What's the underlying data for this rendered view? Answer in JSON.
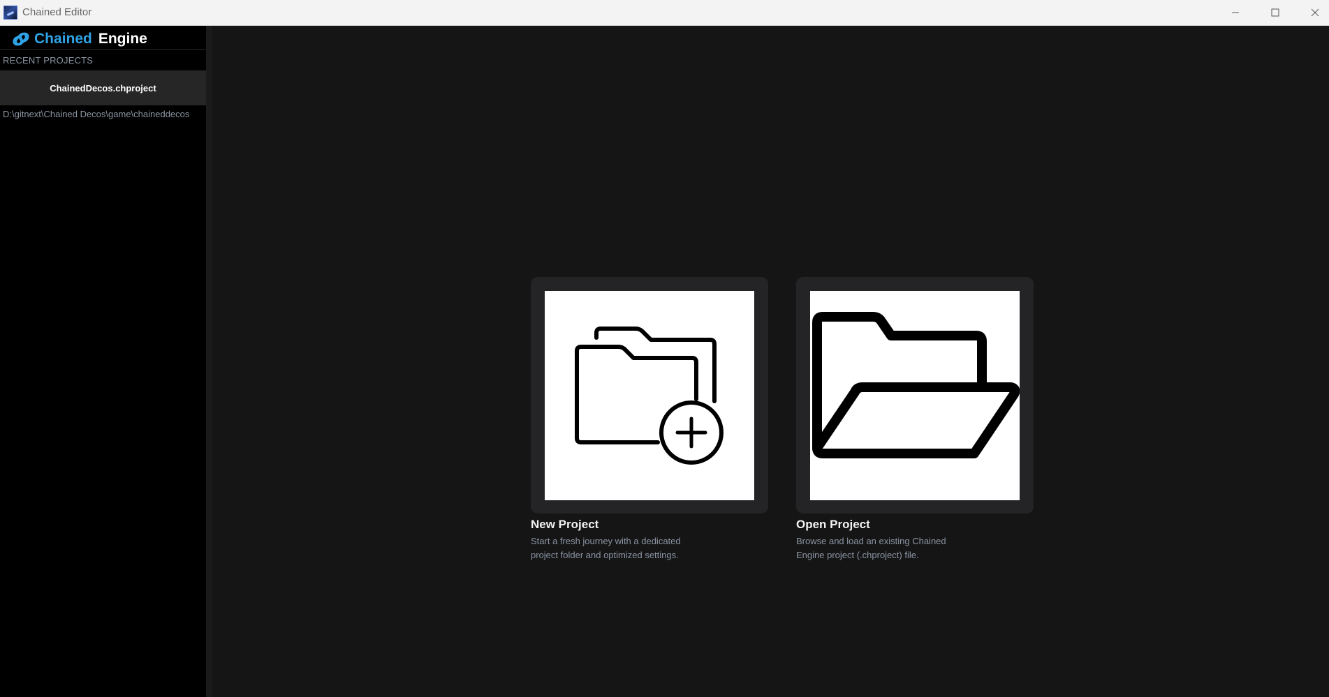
{
  "window": {
    "title": "Chained Editor",
    "controls": [
      "minimize-icon",
      "maximize-icon",
      "close-icon"
    ]
  },
  "brand": {
    "icon": "chain-link-icon",
    "chained": "Chained",
    "engine": "Engine",
    "accent_color": "#2fa3e6"
  },
  "sidebar": {
    "recent_header": "RECENT PROJECTS",
    "recent_projects": [
      {
        "name": "ChainedDecos.chproject",
        "path": "D:\\gitnext\\Chained Decos\\game\\chaineddecos"
      }
    ]
  },
  "actions": {
    "new_project": {
      "icon": "folder-add-icon",
      "title": "New Project",
      "description_line1": "Start a fresh journey with a dedicated",
      "description_line2": "project folder and optimized settings."
    },
    "open_project": {
      "icon": "folder-open-icon",
      "title": "Open Project",
      "description_line1": "Browse and load an existing Chained",
      "description_line2": "Engine project (.chproject) file."
    }
  }
}
